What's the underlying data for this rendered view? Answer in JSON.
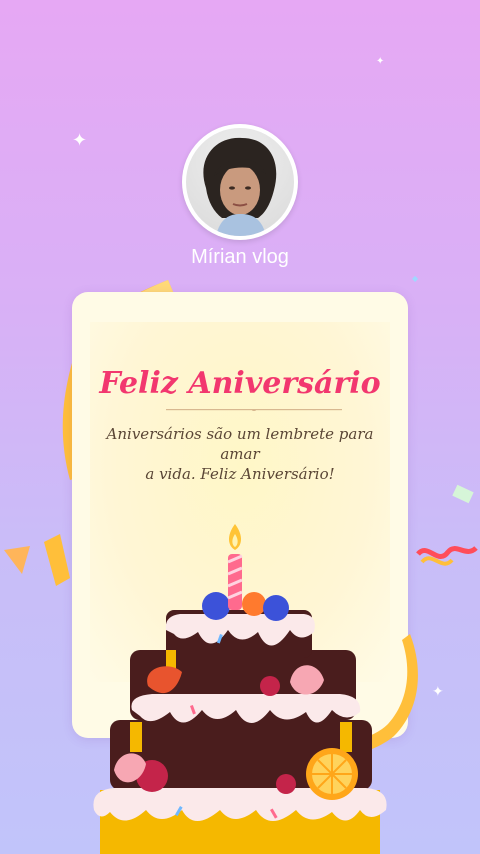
{
  "profile": {
    "name": "Mírian vlog",
    "avatar_icon": "profile-photo"
  },
  "card": {
    "title": "Feliz Aniversário",
    "message_line1": "Aniversários são um lembrete para amar",
    "message_line2": "a vida. Feliz Aniversário!"
  },
  "colors": {
    "background_top": "#e6a8f4",
    "background_bottom": "#c1c4fa",
    "title": "#f2376f",
    "card": "#fffbe6",
    "ribbon": "#ffbf3a"
  }
}
